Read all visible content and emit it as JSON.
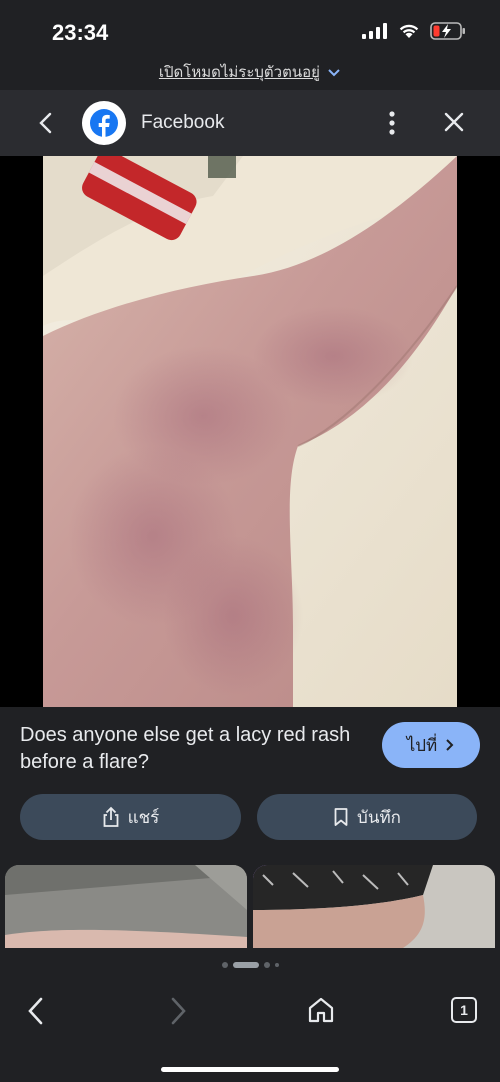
{
  "status_bar": {
    "time": "23:34"
  },
  "incognito_notice": {
    "label": "เปิดโหมดไม่ระบุตัวตนอยู่"
  },
  "toolbar": {
    "site_name": "Facebook"
  },
  "result": {
    "caption": "Does anyone else get a lacy red rash before a flare?",
    "visit_label": "ไปที่",
    "share_label": "แชร์",
    "save_label": "บันทึก"
  },
  "nav": {
    "tab_count": "1"
  },
  "colors": {
    "accent": "#8ab4f8",
    "facebook_blue": "#1877f2",
    "pill_bg": "#3c4a5a"
  },
  "icons": [
    "back-chevron-icon",
    "facebook-logo-icon",
    "more-vert-icon",
    "close-icon",
    "share-icon",
    "bookmark-icon",
    "home-icon",
    "tabs-icon"
  ]
}
